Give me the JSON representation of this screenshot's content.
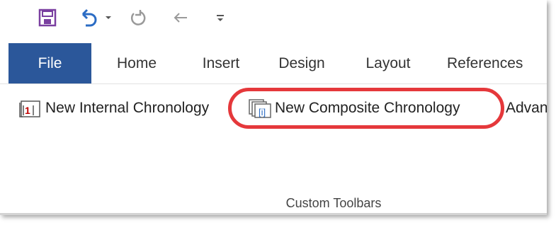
{
  "quick_access": {
    "save_icon": "save-icon",
    "undo_icon": "undo-icon",
    "undo_dropdown_icon": "chevron-down-icon",
    "redo_icon": "redo-icon",
    "back_icon": "arrow-left-icon",
    "customize_icon": "customize-quick-access-icon",
    "colors": {
      "save": "#7a3fa0",
      "undo": "#2b6cc4",
      "disabled": "#9a9a9a"
    }
  },
  "tabs": [
    {
      "label": "File",
      "active": true
    },
    {
      "label": "Home"
    },
    {
      "label": "Insert"
    },
    {
      "label": "Design"
    },
    {
      "label": "Layout"
    },
    {
      "label": "References"
    }
  ],
  "ribbon": {
    "commands": [
      {
        "label": "New Internal Chronology",
        "icon": "internal-chronology-icon"
      },
      {
        "label": "New Composite Chronology",
        "icon": "composite-chronology-icon",
        "highlighted": true
      },
      {
        "label": "Advan",
        "icon": ""
      }
    ],
    "group_label": "Custom Toolbars"
  },
  "colors": {
    "file_tab_bg": "#2b579a",
    "highlight": "#e5383b"
  }
}
